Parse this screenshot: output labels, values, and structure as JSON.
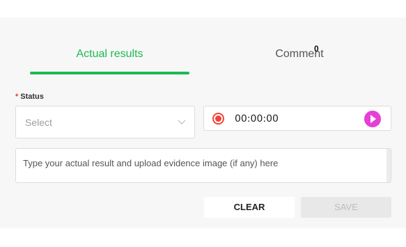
{
  "tabs": [
    {
      "label": "Actual results",
      "active": true
    },
    {
      "label": "Comment",
      "active": false,
      "badge": "0"
    }
  ],
  "status": {
    "required_mark": "*",
    "label": "Status",
    "placeholder": "Select"
  },
  "recorder": {
    "time": "00:00:00"
  },
  "result_input": {
    "placeholder": "Type your actual result and upload evidence image (if any) here"
  },
  "buttons": {
    "clear": "CLEAR",
    "save": "SAVE"
  },
  "colors": {
    "accent": "#1db954",
    "record": "#f44336",
    "play": "#e63fd8"
  }
}
